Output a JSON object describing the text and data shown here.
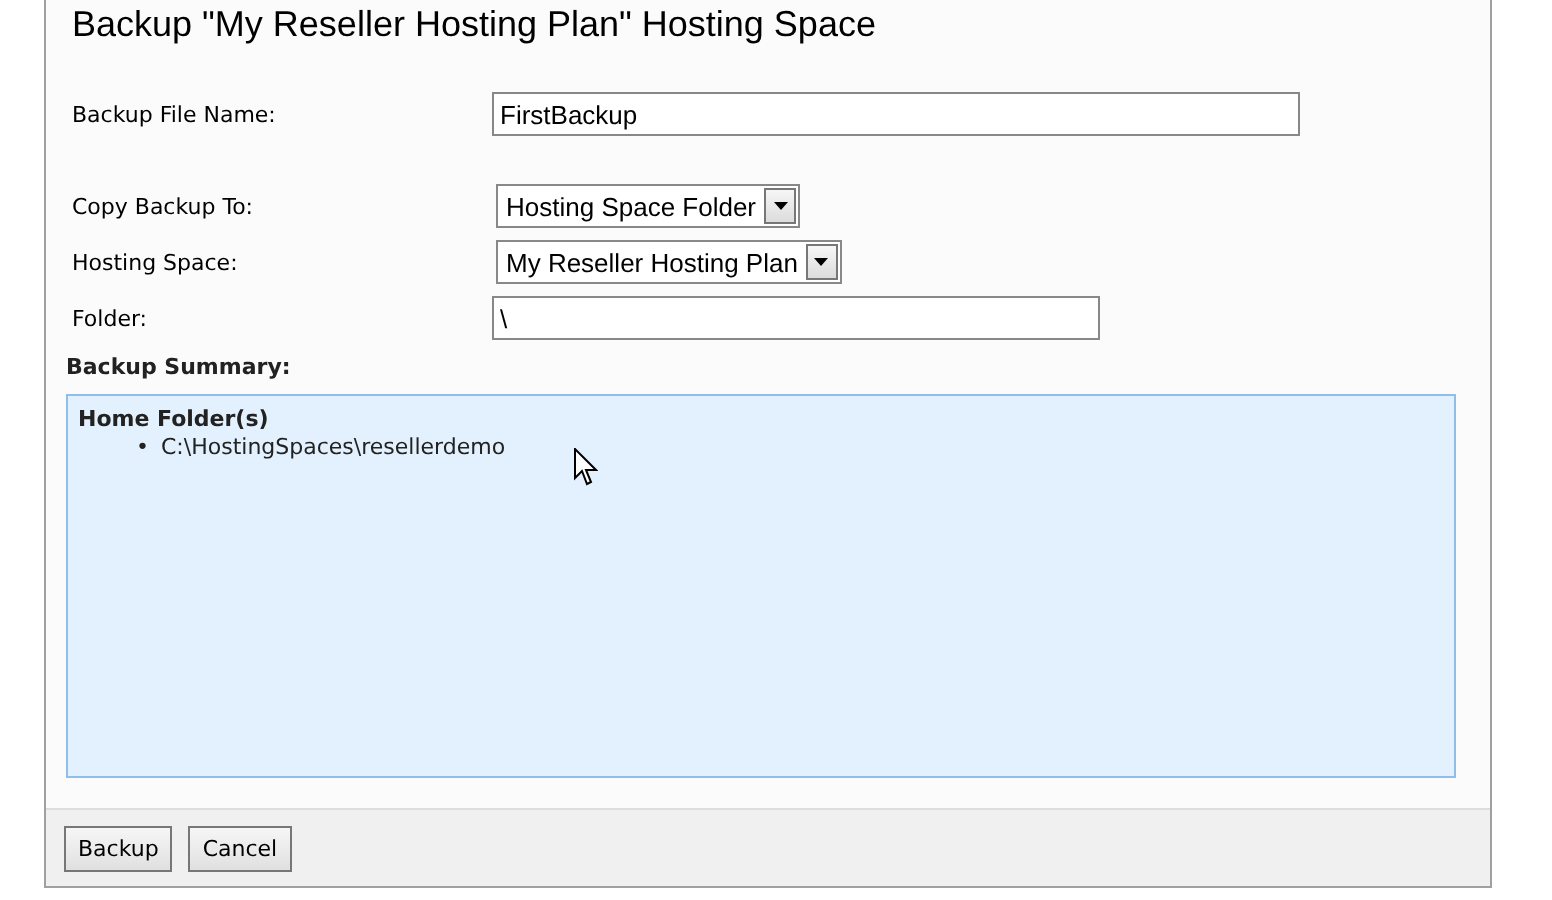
{
  "title": "Backup \"My Reseller Hosting Plan\" Hosting Space",
  "fields": [
    {
      "kind": "text",
      "label": "Backup File Name:",
      "value": "FirstBackup"
    },
    {
      "kind": "select",
      "label": "Copy Backup To:",
      "value": "Hosting Space Folder"
    },
    {
      "kind": "select",
      "label": "Hosting Space:",
      "value": "My Reseller Hosting Plan"
    },
    {
      "kind": "text",
      "label": "Folder:",
      "value": "\\"
    }
  ],
  "summary": {
    "label": "Backup Summary:",
    "heading": "Home Folder(s)",
    "items": [
      {
        "bullet": "•",
        "text": "C:\\HostingSpaces\\resellerdemo"
      }
    ]
  },
  "buttons": [
    "Backup",
    "Cancel"
  ]
}
